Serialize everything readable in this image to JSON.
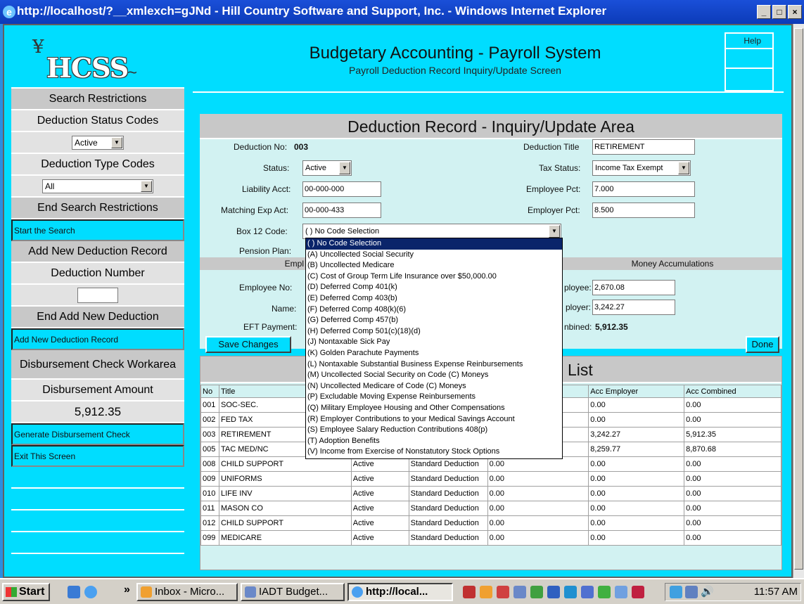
{
  "window": {
    "title": "http://localhost/?__xmlexch=gJNd - Hill Country Software and Support, Inc. - Windows Internet Explorer",
    "minimize": "_",
    "maximize": "□",
    "close": "×"
  },
  "header": {
    "title": "Budgetary Accounting - Payroll System",
    "subtitle": "Payroll Deduction Record Inquiry/Update Screen",
    "help_label": "Help"
  },
  "sidebar": {
    "logo_text": "HCSS",
    "search_restrictions": "Search Restrictions",
    "status_codes_label": "Deduction Status Codes",
    "status_value": "Active",
    "type_codes_label": "Deduction Type Codes",
    "type_value": "All",
    "end_search": "End Search Restrictions",
    "start_search": "Start the Search",
    "add_new_label": "Add New Deduction Record",
    "deduction_number_label": "Deduction Number",
    "deduction_number_value": "",
    "end_add": "End Add New Deduction",
    "add_new_button": "Add New Deduction Record",
    "disbursement_workarea": "Disbursement Check Workarea",
    "disbursement_amount_label": "Disbursement Amount",
    "disbursement_amount": "5,912.35",
    "generate_button": "Generate Disbursement Check",
    "exit_button": "Exit This Screen"
  },
  "form": {
    "panel_title": "Deduction Record - Inquiry/Update Area",
    "deduction_no_label": "Deduction No:",
    "deduction_no": "003",
    "status_label": "Status:",
    "status_value": "Active",
    "liability_label": "Liability Acct:",
    "liability_value": "00-000-000",
    "matching_label": "Matching Exp Act:",
    "matching_value": "00-000-433",
    "box12_label": "Box 12 Code:",
    "box12_value": "( ) No Code Selection",
    "pension_label": "Pension Plan:",
    "title_label": "Deduction Title",
    "title_value": "RETIREMENT",
    "tax_status_label": "Tax Status:",
    "tax_status_value": "Income Tax Exempt",
    "employee_pct_label": "Employee Pct:",
    "employee_pct_value": "7.000",
    "employer_pct_label": "Employer Pct:",
    "employer_pct_value": "8.500",
    "employee_band_label": "Empl",
    "money_accum_label": "Money Accumulations",
    "employee_no_label": "Employee No:",
    "name_label": "Name:",
    "eft_label": "EFT Payment:",
    "acc_employee_label": "ployee:",
    "acc_employee_value": "2,670.08",
    "acc_employer_label": "ployer:",
    "acc_employer_value": "3,242.27",
    "acc_combined_label": "nbined:",
    "acc_combined_value": "5,912.35",
    "save_button": "Save Changes",
    "done_button": "Done"
  },
  "dropdown_options": [
    "( ) No Code Selection",
    "(A) Uncollected Social Security",
    "(B) Uncollected Medicare",
    "(C) Cost of Group Term Life Insurance over $50,000.00",
    "(D) Deferred Comp 401(k)",
    "(E) Deferred Comp 403(b)",
    "(F) Deferred Comp 408(k)(6)",
    "(G) Deferred Comp 457(b)",
    "(H) Deferred Comp 501(c)(18)(d)",
    "(J) Nontaxable Sick Pay",
    "(K) Golden Parachute Payments",
    "(L) Nontaxable Substantial Business Expense Reinbursements",
    "(M) Uncollected Social Security on Code (C) Moneys",
    "(N) Uncollected Medicare of Code (C) Moneys",
    "(P) Excludable Moving Expense Reinbursements",
    "(Q) Military Employee Housing and Other Compensations",
    "(R) Employer Contributions to your Medical Savings Account",
    "(S) Employee Salary Reduction Contributions 408(p)",
    "(T) Adoption Benefits",
    "(V) Income from Exercise of Nonstatutory Stock Options"
  ],
  "list": {
    "title": "List",
    "headers": [
      "No",
      "Title",
      "",
      "",
      "",
      "Acc Employer",
      "Acc Combined"
    ],
    "rows": [
      [
        "001",
        "SOC-SEC.",
        "",
        "",
        "",
        "0.00",
        "0.00"
      ],
      [
        "002",
        "FED TAX",
        "",
        "",
        "",
        "0.00",
        "0.00"
      ],
      [
        "003",
        "RETIREMENT",
        "",
        "",
        "",
        "3,242.27",
        "5,912.35"
      ],
      [
        "005",
        "TAC MED/NC",
        "",
        "",
        "",
        "8,259.77",
        "8,870.68"
      ],
      [
        "008",
        "CHILD SUPPORT",
        "Active",
        "Standard Deduction",
        "0.00",
        "0.00",
        "0.00"
      ],
      [
        "009",
        "UNIFORMS",
        "Active",
        "Standard Deduction",
        "0.00",
        "0.00",
        "0.00"
      ],
      [
        "010",
        "LIFE INV",
        "Active",
        "Standard Deduction",
        "0.00",
        "0.00",
        "0.00"
      ],
      [
        "011",
        "MASON CO",
        "Active",
        "Standard Deduction",
        "0.00",
        "0.00",
        "0.00"
      ],
      [
        "012",
        "CHILD SUPPORT",
        "Active",
        "Standard Deduction",
        "0.00",
        "0.00",
        "0.00"
      ],
      [
        "099",
        "MEDICARE",
        "Active",
        "Standard Deduction",
        "0.00",
        "0.00",
        "0.00"
      ]
    ]
  },
  "taskbar": {
    "start": "Start",
    "chevron": "»",
    "btn1": "Inbox - Micro...",
    "btn2": "IADT Budget...",
    "btn3": "http://local...",
    "clock": "11:57 AM"
  },
  "colors": {
    "accent_cyan": "#00ddff",
    "title_blue": "#0c3bb8",
    "selection": "#0a246a"
  }
}
